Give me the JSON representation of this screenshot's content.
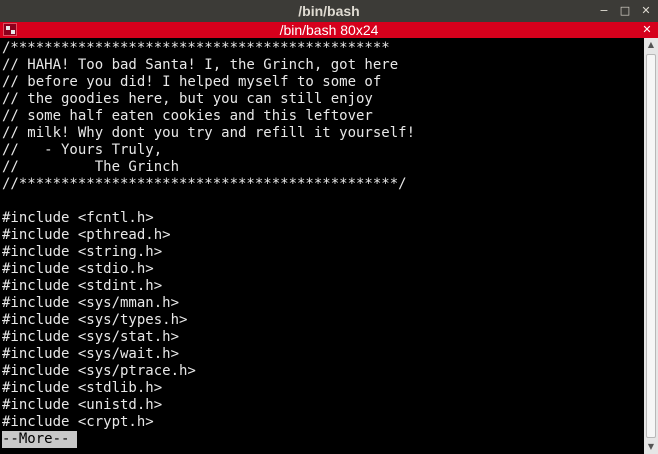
{
  "window": {
    "title": "/bin/bash",
    "controls": [
      {
        "name": "minimize-icon",
        "glyph": "−"
      },
      {
        "name": "maximize-icon",
        "glyph": "□"
      },
      {
        "name": "close-icon",
        "glyph": "✕"
      }
    ]
  },
  "tab": {
    "title": "/bin/bash 80x24",
    "close_glyph": "✕"
  },
  "terminal": {
    "lines": [
      "/*********************************************",
      "// HAHA! Too bad Santa! I, the Grinch, got here",
      "// before you did! I helped myself to some of",
      "// the goodies here, but you can still enjoy",
      "// some half eaten cookies and this leftover",
      "// milk! Why dont you try and refill it yourself!",
      "//   - Yours Truly,",
      "//         The Grinch",
      "//*********************************************/",
      "",
      "#include <fcntl.h>",
      "#include <pthread.h>",
      "#include <string.h>",
      "#include <stdio.h>",
      "#include <stdint.h>",
      "#include <sys/mman.h>",
      "#include <sys/types.h>",
      "#include <sys/stat.h>",
      "#include <sys/wait.h>",
      "#include <sys/ptrace.h>",
      "#include <stdlib.h>",
      "#include <unistd.h>",
      "#include <crypt.h>"
    ],
    "more_prompt": "--More--"
  },
  "scrollbar": {
    "up_glyph": "▲",
    "down_glyph": "▼"
  },
  "colors": {
    "tab_bar": "#d6001c",
    "terminal_bg": "#000000",
    "terminal_fg": "#e8e8e8"
  }
}
